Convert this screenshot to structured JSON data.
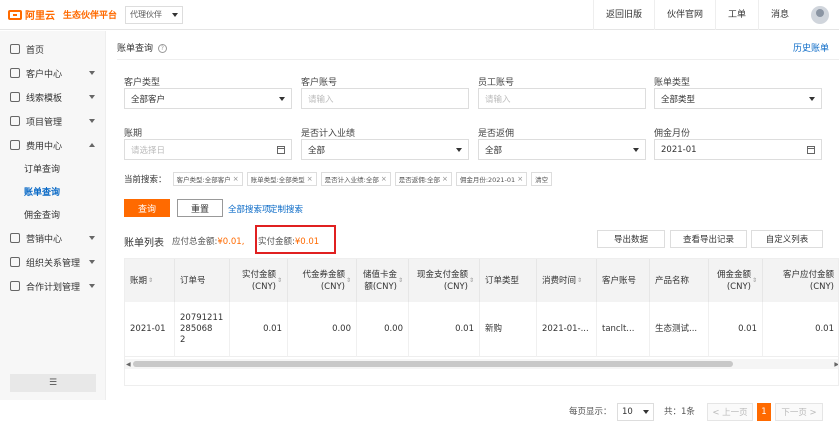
{
  "topbar": {
    "logo": "阿里云",
    "brand_sub": "生态伙伴平台",
    "role_select": "代理伙伴",
    "nav": [
      "返回旧版",
      "伙伴官网",
      "工单",
      "消息"
    ]
  },
  "sidebar": {
    "items": [
      {
        "label": "首页"
      },
      {
        "label": "客户中心"
      },
      {
        "label": "线索模板"
      },
      {
        "label": "项目管理"
      },
      {
        "label": "费用中心"
      },
      {
        "label": "订单查询"
      },
      {
        "label": "账单查询"
      },
      {
        "label": "佣金查询"
      },
      {
        "label": "营销中心"
      },
      {
        "label": "组织关系管理"
      },
      {
        "label": "合作计划管理"
      }
    ],
    "collapse": "☰"
  },
  "page": {
    "title": "账单查询",
    "help": "?",
    "history_link": "历史账单"
  },
  "form": {
    "customer_type_label": "客户类型",
    "customer_type_value": "全部客户",
    "customer_account_label": "客户账号",
    "customer_account_placeholder": "请输入",
    "employee_account_label": "员工账号",
    "employee_account_placeholder": "请输入",
    "bill_type_label": "账单类型",
    "bill_type_value": "全部类型",
    "period_label": "账期",
    "period_placeholder": "请选择日",
    "perf_label": "是否计入业绩",
    "perf_value": "全部",
    "rebate_label": "是否返佣",
    "rebate_value": "全部",
    "commission_month_label": "佣金月份",
    "commission_month_value": "2021-01"
  },
  "filters": {
    "label": "当前搜索：",
    "tags": [
      "客户类型:全部客户",
      "账单类型:全部类型",
      "是否计入业绩:全部",
      "是否返佣:全部",
      "佣金月份:2021-01",
      "清空"
    ],
    "close": "×"
  },
  "actions": {
    "query": "查询",
    "reset": "重置",
    "link_a": "全部搜索项",
    "link_b": "定制搜索"
  },
  "summary": {
    "list_title": "账单列表",
    "payable_label": "应付总金额:",
    "payable_value": "¥0.01,",
    "paid_label": "实付金额:",
    "paid_value": "¥0.01"
  },
  "toolbar": {
    "export": "导出数据",
    "view_export": "查看导出记录",
    "custom_cols": "自定义列表"
  },
  "table": {
    "headers": [
      "账期",
      "订单号",
      "实付金额\n(CNY)",
      "代金券金额\n(CNY)",
      "储值卡金\n额(CNY)",
      "现金支付金额\n(CNY)",
      "订单类型",
      "消费时间",
      "客户账号",
      "产品名称",
      "佣金金额\n(CNY)",
      "客户应付金额\n(CNY)"
    ],
    "sort_icon": "⇕",
    "rows": [
      [
        "2021-01",
        "20791211285068\n2",
        "0.01",
        "0.00",
        "0.00",
        "0.01",
        "新购",
        "2021-01-...",
        "tanclt...",
        "生态测试...",
        "0.01",
        "0.01"
      ]
    ],
    "scroll_left": "◀",
    "scroll_right": "▶"
  },
  "pagination": {
    "per_page_label": "每页显示：",
    "per_page_value": "10",
    "total": "共：1条",
    "prev": "< 上一页",
    "current": "1",
    "next": "下一页 >"
  }
}
